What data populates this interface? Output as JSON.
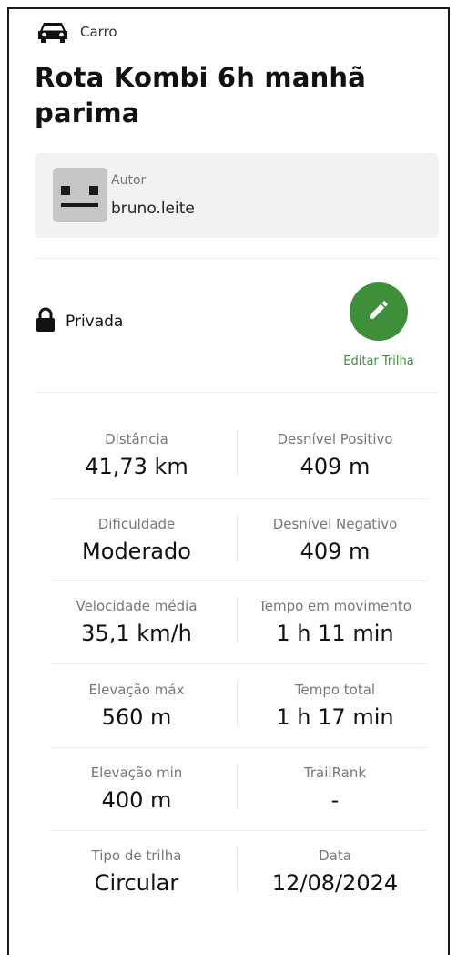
{
  "activity": {
    "icon": "car-icon",
    "label": "Carro"
  },
  "title": "Rota Kombi 6h manhã parima",
  "author": {
    "label": "Autor",
    "name": "bruno.leite",
    "avatar_icon": "robot-face-avatar"
  },
  "privacy": {
    "icon": "lock-icon",
    "label": "Privada"
  },
  "edit": {
    "icon": "pencil-icon",
    "label": "Editar Trilha",
    "color": "#3d8f39"
  },
  "stats": [
    {
      "label": "Distância",
      "value": "41,73 km"
    },
    {
      "label": "Desnível Positivo",
      "value": "409 m"
    },
    {
      "label": "Dificuldade",
      "value": "Moderado"
    },
    {
      "label": "Desnível Negativo",
      "value": "409 m"
    },
    {
      "label": "Velocidade média",
      "value": "35,1 km/h"
    },
    {
      "label": "Tempo em movimento",
      "value": "1 h 11 min"
    },
    {
      "label": "Elevação máx",
      "value": "560 m"
    },
    {
      "label": "Tempo total",
      "value": "1 h 17 min"
    },
    {
      "label": "Elevação min",
      "value": "400 m"
    },
    {
      "label": "TrailRank",
      "value": "-"
    },
    {
      "label": "Tipo de trilha",
      "value": "Circular"
    },
    {
      "label": "Data",
      "value": "12/08/2024"
    }
  ]
}
